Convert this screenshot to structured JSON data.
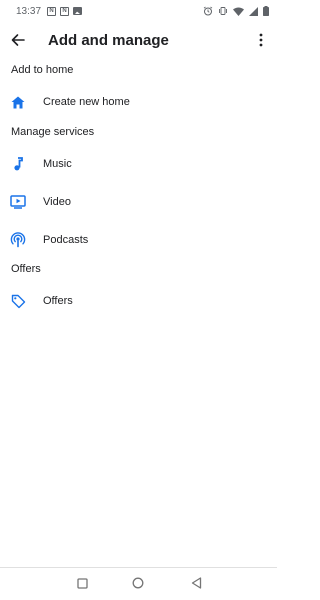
{
  "status_bar": {
    "time": "13:37",
    "notification_icons": [
      "N",
      "N"
    ]
  },
  "app_bar": {
    "title": "Add and manage"
  },
  "sections": {
    "add_to_home": {
      "header": "Add to home",
      "items": [
        {
          "label": "Create new home",
          "icon": "home-icon"
        }
      ]
    },
    "manage_services": {
      "header": "Manage services",
      "items": [
        {
          "label": "Music",
          "icon": "music-note-icon"
        },
        {
          "label": "Video",
          "icon": "video-icon"
        },
        {
          "label": "Podcasts",
          "icon": "podcast-icon"
        }
      ]
    },
    "offers": {
      "header": "Offers",
      "items": [
        {
          "label": "Offers",
          "icon": "tag-icon"
        }
      ]
    }
  },
  "colors": {
    "accent": "#1a73e8",
    "text": "#202124",
    "status": "#5f6368"
  }
}
